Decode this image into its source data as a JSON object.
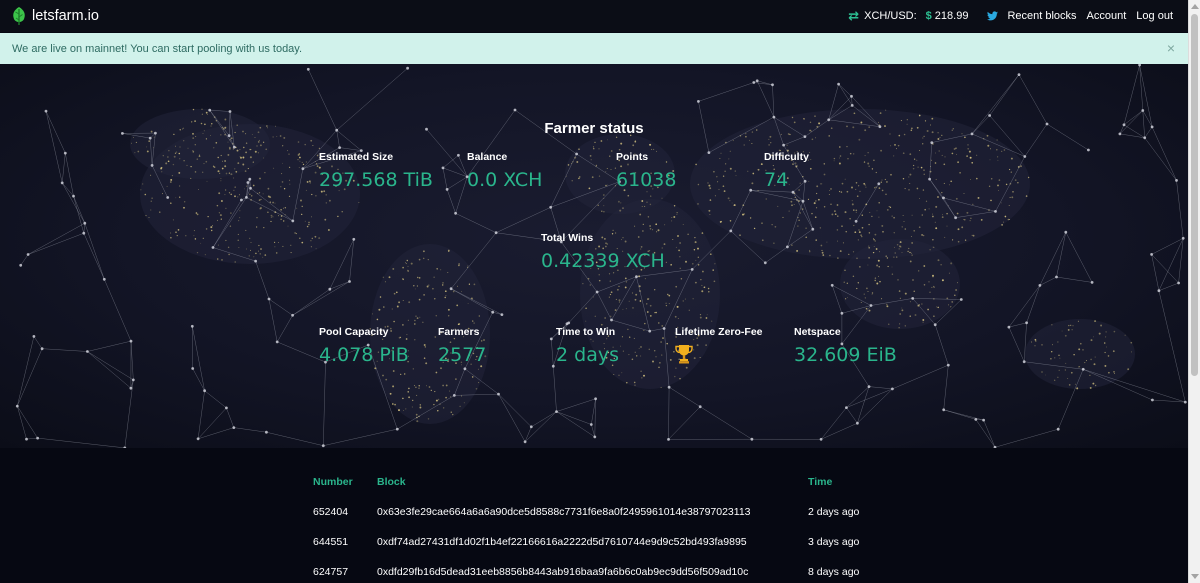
{
  "navbar": {
    "brand": "letsfarm.io",
    "rate_label": "XCH/USD:",
    "rate_currency": "$",
    "rate_value": "218.99",
    "links": [
      "Recent blocks",
      "Account",
      "Log out"
    ],
    "icons": [
      "swap-icon",
      "twitter-icon"
    ]
  },
  "alert": {
    "message": "We are live on mainnet! You can start pooling with us today.",
    "close": "×"
  },
  "farmer": {
    "title": "Farmer status",
    "estimated_size": {
      "label": "Estimated Size",
      "value": "297.568 TiB"
    },
    "balance": {
      "label": "Balance",
      "value": "0.0 XCH"
    },
    "points": {
      "label": "Points",
      "value": "61038"
    },
    "difficulty": {
      "label": "Difficulty",
      "value": "74"
    },
    "total_wins": {
      "label": "Total Wins",
      "value": "0.42339 XCH"
    },
    "pool_capacity": {
      "label": "Pool Capacity",
      "value": "4.078 PiB"
    },
    "farmers": {
      "label": "Farmers",
      "value": "2577"
    },
    "time_to_win": {
      "label": "Time to Win",
      "value": "2 days"
    },
    "lifetime_zero_fee": {
      "label": "Lifetime Zero-Fee",
      "icon": "trophy-icon"
    },
    "netspace": {
      "label": "Netspace",
      "value": "32.609 EiB"
    }
  },
  "blocks": {
    "headers": {
      "number": "Number",
      "block": "Block",
      "time": "Time"
    },
    "rows": [
      {
        "number": "652404",
        "block": "0x63e3fe29cae664a6a6a90dce5d8588c7731f6e8a0f2495961014e38797023113",
        "time": "2 days ago"
      },
      {
        "number": "644551",
        "block": "0xdf74ad27431df1d02f1b4ef22166616a2222d5d7610744e9d9c52bd493fa9895",
        "time": "3 days ago"
      },
      {
        "number": "624757",
        "block": "0xdfd29fb16d5dead31eeb8856b8443ab916baa9fa6b6c0ab9ec9dd56f509ad10c",
        "time": "8 days ago"
      }
    ]
  },
  "colors": {
    "accent": "#2ab58c",
    "navbar_bg": "#0b0d16",
    "alert_bg": "#d1f2eb",
    "alert_text": "#2e6b62",
    "page_bg": "#060812"
  }
}
